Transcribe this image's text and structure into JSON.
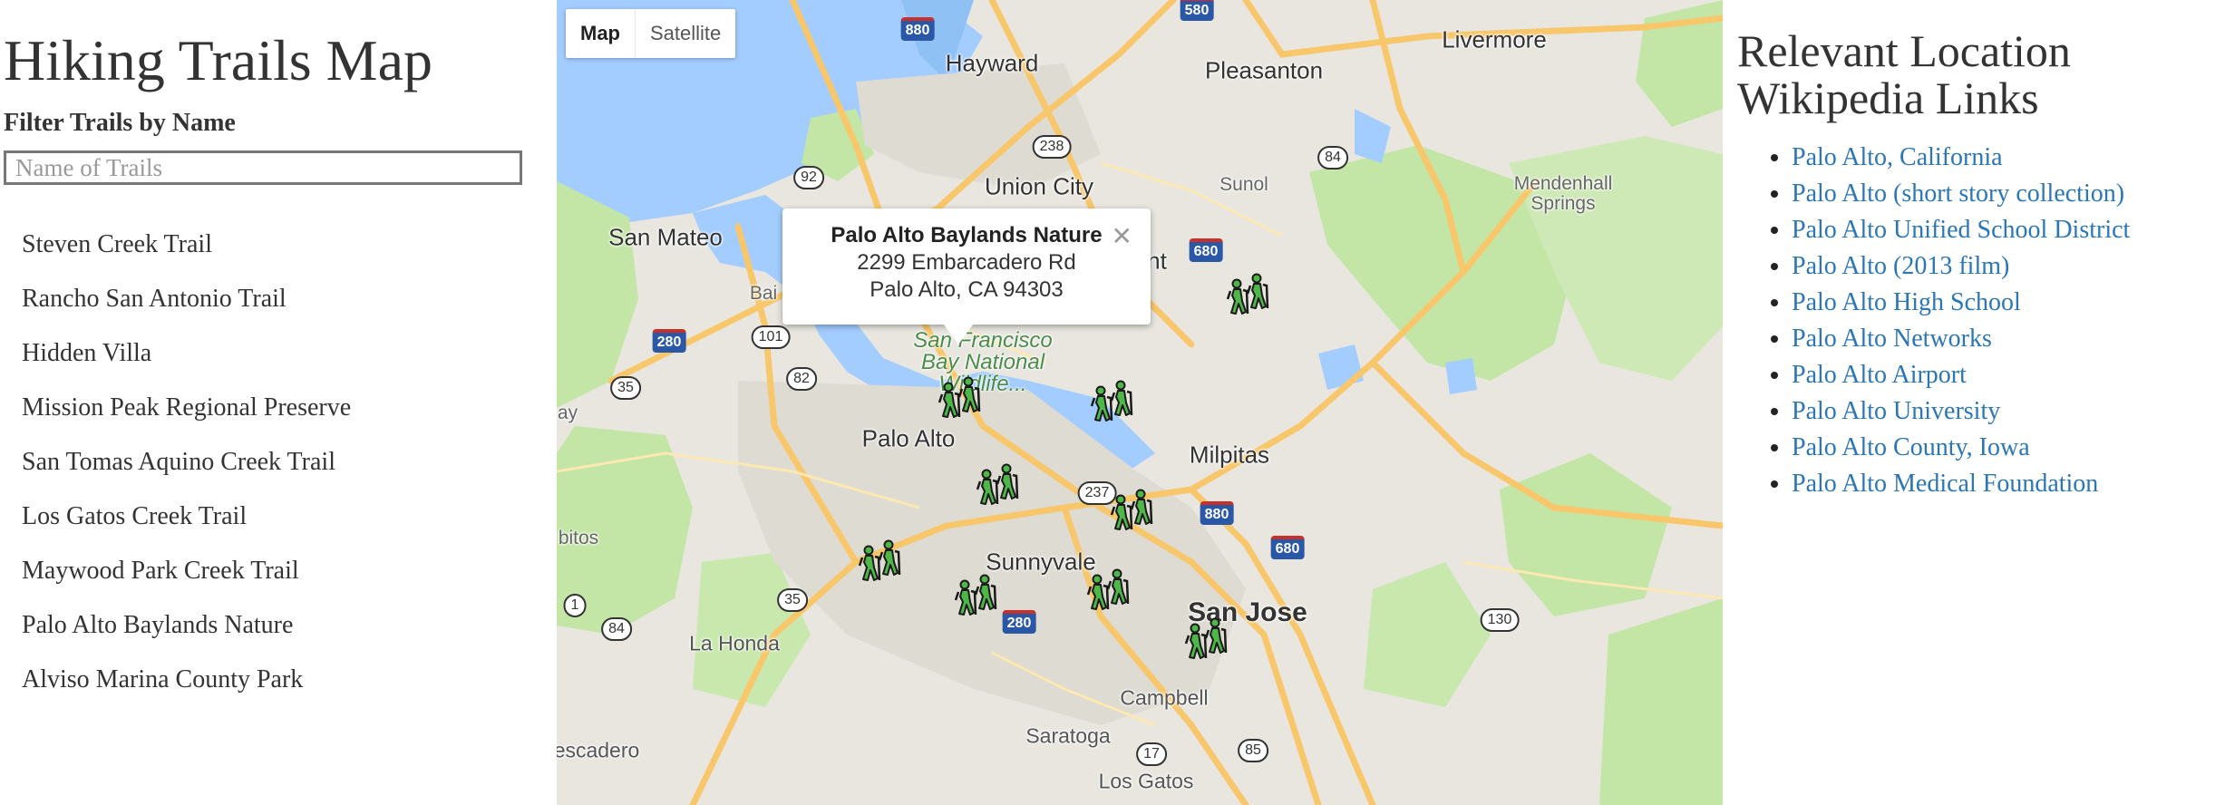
{
  "left": {
    "title": "Hiking Trails Map",
    "filter_label": "Filter Trails by Name",
    "filter_placeholder": "Name of Trails",
    "filter_value": "",
    "trails": [
      "Steven Creek Trail",
      "Rancho San Antonio Trail",
      "Hidden Villa",
      "Mission Peak Regional Preserve",
      "San Tomas Aquino Creek Trail",
      "Los Gatos Creek Trail",
      "Maywood Park Creek Trail",
      "Palo Alto Baylands Nature",
      "Alviso Marina County Park"
    ]
  },
  "map": {
    "map_type_options": [
      "Map",
      "Satellite"
    ],
    "selected_map_type": "Map",
    "place_labels": {
      "hayward": "Hayward",
      "pleasanton": "Pleasanton",
      "livermore": "Livermore",
      "union_city": "Union City",
      "sunol": "Sunol",
      "mendenhall": "Mendenhall\nSprings",
      "san_mateo": "San Mateo",
      "palo_alto": "Palo Alto",
      "milpitas": "Milpitas",
      "sunnyvale": "Sunnyvale",
      "san_jose": "San Jose",
      "la_honda": "La Honda",
      "campbell": "Campbell",
      "saratoga": "Saratoga",
      "los_gatos": "Los Gatos",
      "escadero": "escadero",
      "bitos": "bitos",
      "ay": "ay",
      "bai": "Bai",
      "nt": "nt",
      "refuge": "San Francisco\nBay National\nWildlife..."
    },
    "route_shields": [
      "880",
      "580",
      "238",
      "84",
      "92",
      "680",
      "280",
      "101",
      "82",
      "35",
      "237",
      "880",
      "680",
      "84",
      "35",
      "1",
      "280",
      "17",
      "85",
      "130",
      "101"
    ],
    "info_window": {
      "name": "Palo Alto Baylands Nature",
      "address_line1": "2299 Embarcadero Rd",
      "address_line2": "Palo Alto, CA 94303",
      "close_glyph": "✕"
    },
    "marker_icon": "hiker-icon",
    "colors": {
      "water": "#a3ccff",
      "land": "#e8e6df",
      "park": "#c3e6a6",
      "highway": "#f9c76b",
      "marker_green": "#4db848"
    }
  },
  "right": {
    "title": "Relevant Location Wikipedia Links",
    "links": [
      "Palo Alto, California",
      "Palo Alto (short story collection)",
      "Palo Alto Unified School District",
      "Palo Alto (2013 film)",
      "Palo Alto High School",
      "Palo Alto Networks",
      "Palo Alto Airport",
      "Palo Alto University",
      "Palo Alto County, Iowa",
      "Palo Alto Medical Foundation"
    ],
    "link_color": "#2a76b6"
  }
}
